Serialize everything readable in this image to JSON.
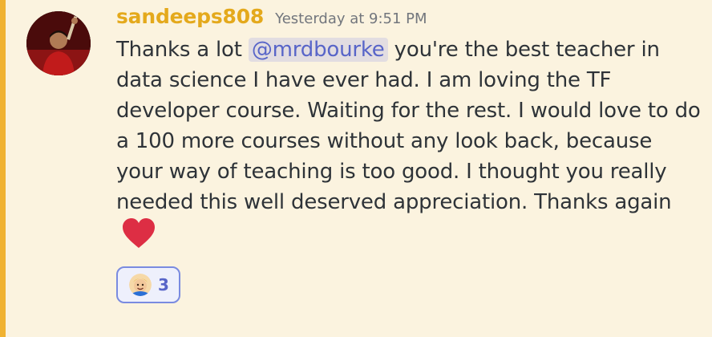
{
  "message": {
    "author": "sandeeps808",
    "timestamp": "Yesterday at 9:51 PM",
    "text_before_mention": "Thanks a lot ",
    "mention": "@mrdbourke",
    "text_after_mention": " you're the best teacher in data science I have ever had. I am loving the TF developer course. Waiting for the rest. I would love to do a 100 more courses without any look back, because your way of teaching is too good. I thought you really needed this well deserved appreciation. Thanks again ",
    "emoji": "heart-emoji"
  },
  "reactions": [
    {
      "emoji": "avatar-emoji",
      "count": "3"
    }
  ],
  "colors": {
    "highlight_bar": "#f0b232",
    "username": "#e4a91c",
    "mention": "#5865c8",
    "heart": "#dd2e44"
  }
}
